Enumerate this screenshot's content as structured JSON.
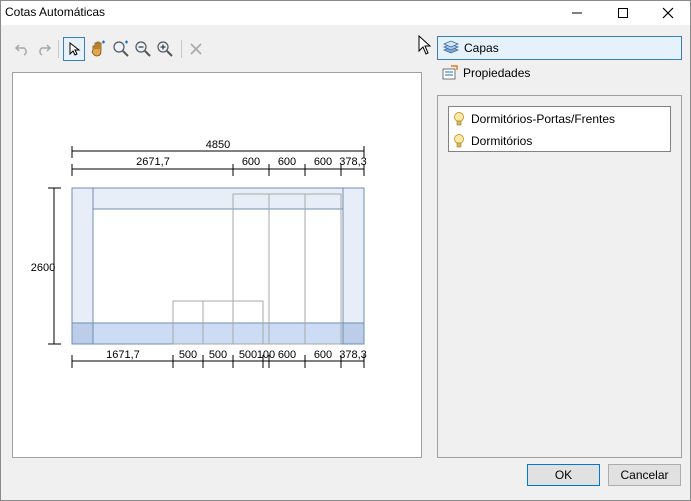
{
  "window": {
    "title": "Cotas Automáticas"
  },
  "tabs": [
    {
      "label": "Capas",
      "icon": "layers-icon",
      "selected": true
    },
    {
      "label": "Propiedades",
      "icon": "properties-icon",
      "selected": false
    }
  ],
  "layers": [
    {
      "label": "Dormitórios-Portas/Frentes",
      "icon": "lightbulb-icon"
    },
    {
      "label": "Dormitórios",
      "icon": "lightbulb-icon"
    }
  ],
  "toolbar": {
    "tools": [
      "undo-icon",
      "redo-icon",
      "select-arrow-icon",
      "pan-hand-icon",
      "zoom-window-icon",
      "zoom-out-icon",
      "zoom-in-icon",
      "delete-icon"
    ]
  },
  "dimensions": {
    "top_total": "4850",
    "top_segments": [
      "2671,7",
      "600",
      "600",
      "600",
      "378,3"
    ],
    "height": "2600",
    "bottom_segments": [
      "1671,7",
      "500",
      "500",
      "500",
      "100",
      "600",
      "600",
      "378,3"
    ]
  },
  "buttons": {
    "ok": "OK",
    "cancel": "Cancelar"
  },
  "colors": {
    "accent": "#3c7fb1",
    "panel_fill": "#e8eef7",
    "base_fill": "#ccdcf5"
  }
}
